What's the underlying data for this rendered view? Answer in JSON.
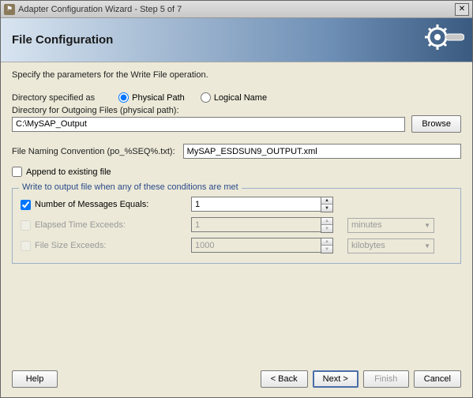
{
  "window": {
    "title": "Adapter Configuration Wizard - Step 5 of 7"
  },
  "header": {
    "title": "File Configuration"
  },
  "instruction": "Specify the parameters for the Write File operation.",
  "dirSpec": {
    "label": "Directory specified as",
    "physical": "Physical Path",
    "logical": "Logical Name",
    "selected": "physical"
  },
  "outDir": {
    "label": "Directory for Outgoing Files (physical path):",
    "value": "C:\\MySAP_Output",
    "browse": "Browse"
  },
  "naming": {
    "label": "File Naming Convention (po_%SEQ%.txt):",
    "value": "MySAP_ESDSUN9_OUTPUT.xml"
  },
  "append": {
    "label": "Append to existing file",
    "checked": false
  },
  "conditions": {
    "legend": "Write to output file when any of these conditions are met",
    "msgEquals": {
      "label": "Number of Messages Equals:",
      "value": "1",
      "checked": true
    },
    "elapsed": {
      "label": "Elapsed Time Exceeds:",
      "value": "1",
      "unit": "minutes",
      "checked": false
    },
    "fileSize": {
      "label": "File Size Exceeds:",
      "value": "1000",
      "unit": "kilobytes",
      "checked": false
    }
  },
  "footer": {
    "help": "Help",
    "back": "< Back",
    "next": "Next >",
    "finish": "Finish",
    "cancel": "Cancel"
  }
}
